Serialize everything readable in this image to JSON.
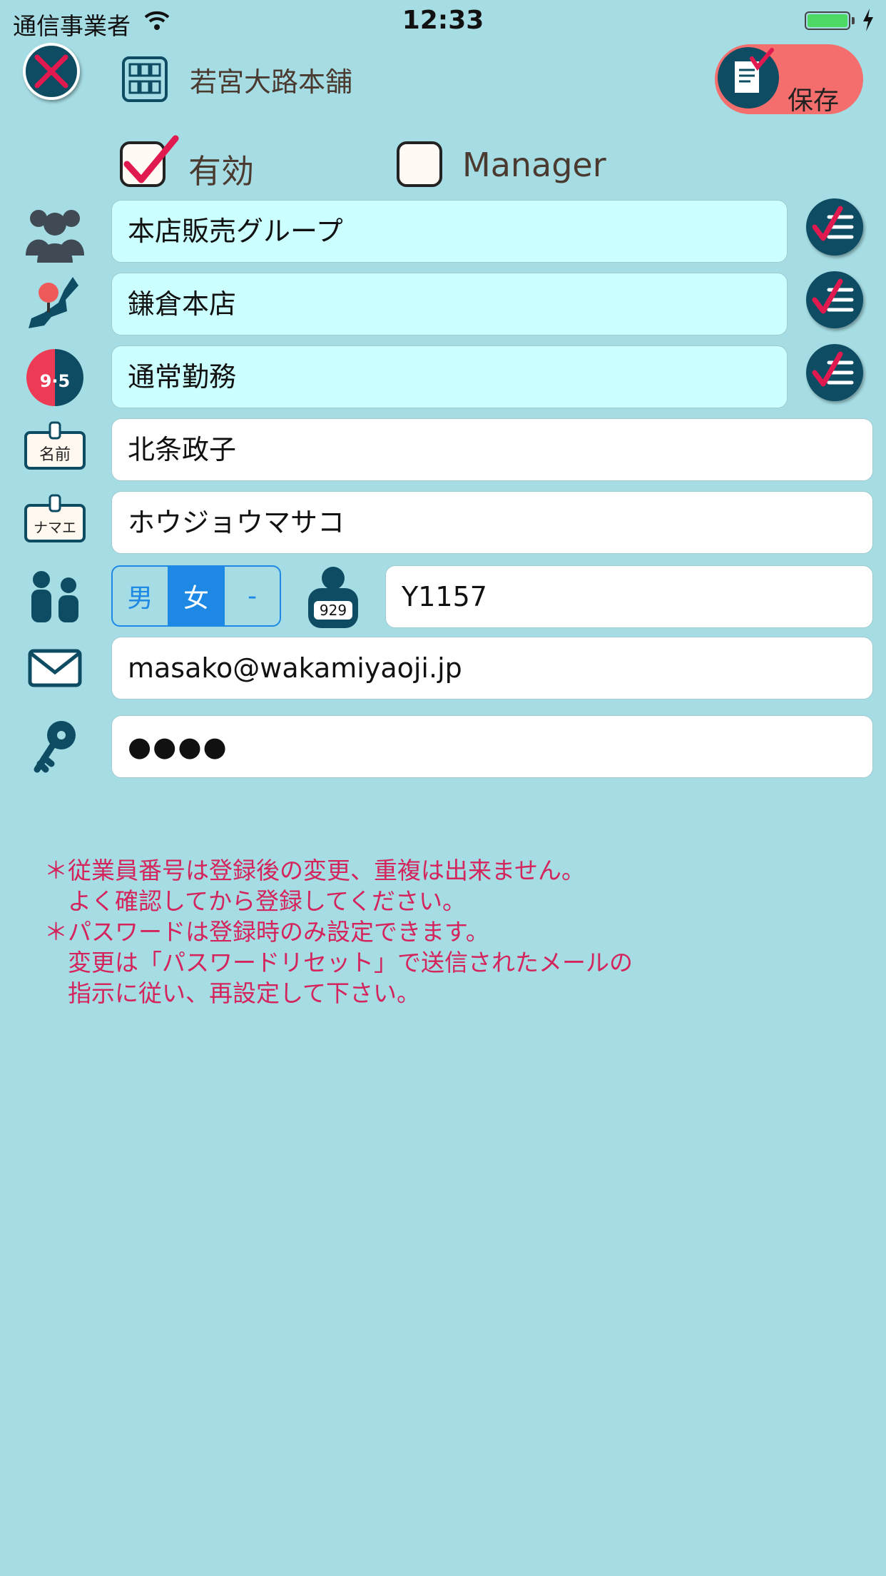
{
  "status_bar": {
    "carrier": "通信事業者",
    "time": "12:33"
  },
  "header": {
    "store_name": "若宮大路本舗",
    "save_label": "保存"
  },
  "flags": {
    "active_label": "有効",
    "active_checked": true,
    "manager_label": "Manager",
    "manager_checked": false
  },
  "fields": {
    "group": "本店販売グループ",
    "location": "鎌倉本店",
    "shift": "通常勤務",
    "name": "北条政子",
    "name_kana": "ホウジョウマサコ",
    "employee_id": "Y1157",
    "email": "masako@wakamiyaoji.jp",
    "password": "●●●●"
  },
  "gender": {
    "options": [
      "男",
      "女",
      "-"
    ],
    "selected": "女"
  },
  "icons": {
    "id_badge": "929",
    "shift_badge": "9·5",
    "name_tag": "名前",
    "kana_tag": "ナマエ"
  },
  "notes": [
    "＊従業員番号は登録後の変更、重複は出来ません。",
    "　よく確認してから登録してください。",
    "＊パスワードは登録時のみ設定できます。",
    "　変更は「パスワードリセット」で送信されたメールの",
    "　指示に従い、再設定して下さい。"
  ],
  "colors": {
    "background": "#a6dde4",
    "accent": "#1e88e5",
    "save": "#f36e6c",
    "icon_dark": "#0e4c63",
    "note": "#d4245c",
    "check": "#e0194e"
  }
}
